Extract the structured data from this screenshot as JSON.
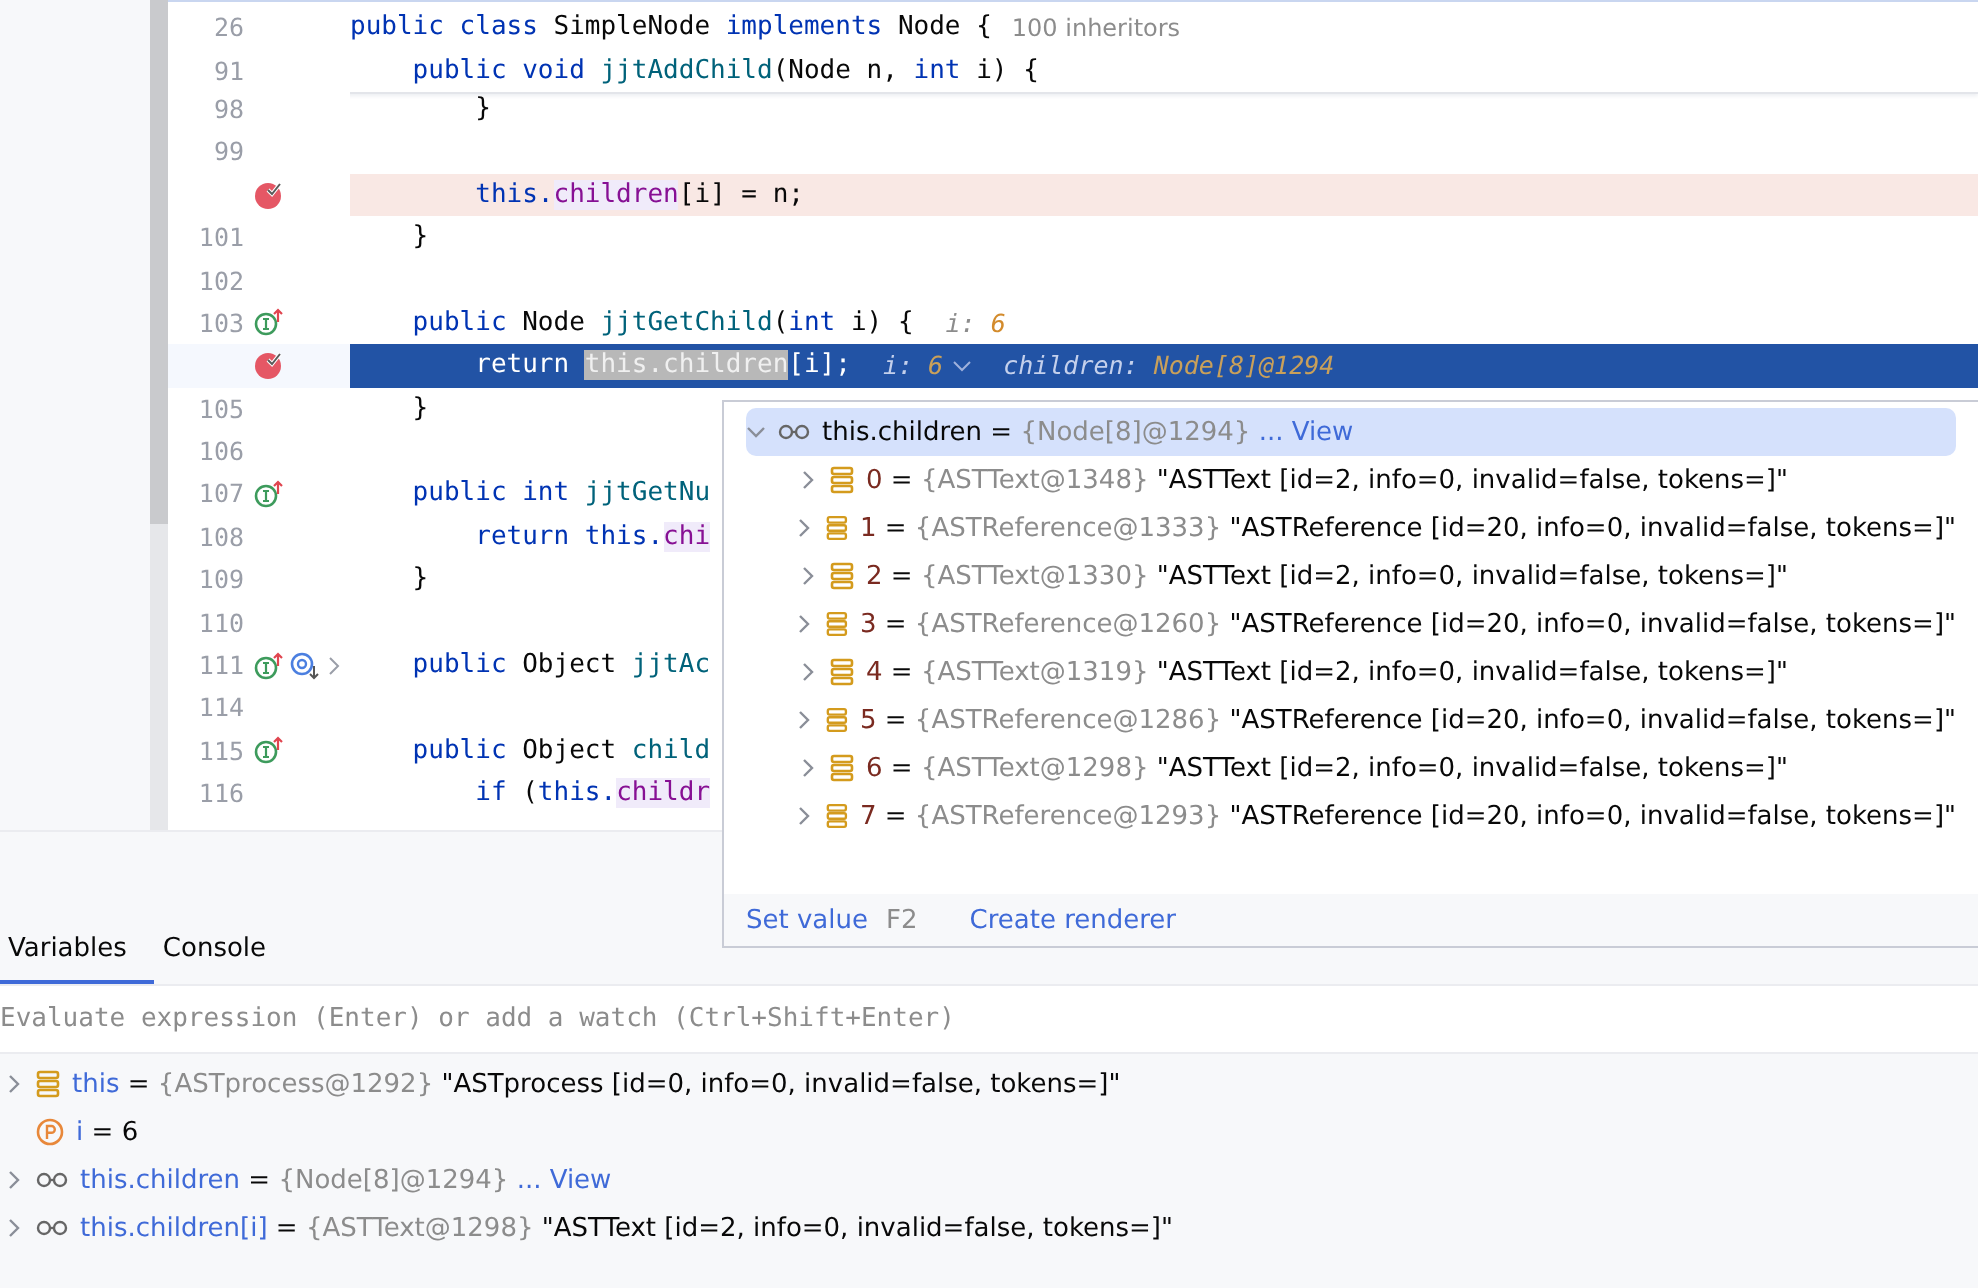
{
  "editor": {
    "sticky_lines": [
      {
        "number": "26",
        "tokens": [
          {
            "text": "public class ",
            "kind": "kw"
          },
          {
            "text": "SimpleNode ",
            "kind": "plain"
          },
          {
            "text": "implements ",
            "kind": "kw"
          },
          {
            "text": "Node {",
            "kind": "plain"
          }
        ],
        "hints": [
          {
            "text": "100 inheritors",
            "kind": "usage"
          }
        ]
      },
      {
        "number": "91",
        "tokens": [
          {
            "text": "    public void ",
            "kind": "kw"
          },
          {
            "text": "jjtAddChild",
            "kind": "method"
          },
          {
            "text": "(Node n, ",
            "kind": "plain"
          },
          {
            "text": "int ",
            "kind": "kw"
          },
          {
            "text": "i) {",
            "kind": "plain"
          }
        ]
      }
    ],
    "lines": [
      {
        "number": "98",
        "kind": "code",
        "tokens": [
          {
            "text": "        }",
            "kind": "plain"
          }
        ]
      },
      {
        "number": "99",
        "kind": "code"
      },
      {
        "kind": "breakpoint",
        "gutter": [
          {
            "kind": "breakpoint"
          }
        ],
        "tokens": [
          {
            "text": "        this.",
            "kind": "kw"
          },
          {
            "text": "children",
            "kind": "field-ref"
          },
          {
            "text": "[i] = n;",
            "kind": "plain"
          }
        ]
      },
      {
        "number": "101",
        "kind": "code",
        "tokens": [
          {
            "text": "    }",
            "kind": "plain"
          }
        ]
      },
      {
        "number": "102",
        "kind": "code"
      },
      {
        "number": "103",
        "kind": "code",
        "gutter": [
          {
            "kind": "implements"
          }
        ],
        "tokens": [
          {
            "text": "    public ",
            "kind": "kw"
          },
          {
            "text": "Node ",
            "kind": "plain"
          },
          {
            "text": "jjtGetChild",
            "kind": "method"
          },
          {
            "text": "(",
            "kind": "plain"
          },
          {
            "text": "int ",
            "kind": "kw"
          },
          {
            "text": "i) {",
            "kind": "plain"
          }
        ],
        "hints": [
          {
            "text": "i: ",
            "value": "6",
            "kind": "value",
            "expandable": false
          }
        ]
      },
      {
        "kind": "current",
        "gutter": [
          {
            "kind": "breakpoint"
          }
        ],
        "tokens": [
          {
            "text": "        return ",
            "kind": "kw"
          },
          {
            "text": "this.children",
            "kind": "eval"
          },
          {
            "text": "[i];",
            "kind": "plain"
          }
        ],
        "hints": [
          {
            "text": "i: ",
            "value": "6",
            "kind": "value",
            "expandable": true
          },
          {
            "text": "children: ",
            "value": "Node[8]@1294",
            "kind": "value",
            "expandable": false
          }
        ]
      },
      {
        "number": "105",
        "kind": "code",
        "tokens": [
          {
            "text": "    }",
            "kind": "plain"
          }
        ]
      },
      {
        "number": "106",
        "kind": "code"
      },
      {
        "number": "107",
        "kind": "code",
        "gutter": [
          {
            "kind": "implements"
          }
        ],
        "tokens": [
          {
            "text": "    public int ",
            "kind": "kw"
          },
          {
            "text": "jjtGetNu",
            "kind": "method"
          }
        ]
      },
      {
        "number": "108",
        "kind": "code",
        "tokens": [
          {
            "text": "        return this.",
            "kind": "kw"
          },
          {
            "text": "chi",
            "kind": "field-ref"
          }
        ]
      },
      {
        "number": "109",
        "kind": "code",
        "tokens": [
          {
            "text": "    }",
            "kind": "plain"
          }
        ]
      },
      {
        "number": "110",
        "kind": "code"
      },
      {
        "number": "111",
        "kind": "code",
        "gutter": [
          {
            "kind": "implements"
          },
          {
            "kind": "overridden"
          },
          {
            "kind": "fold"
          }
        ],
        "tokens": [
          {
            "text": "    public ",
            "kind": "kw"
          },
          {
            "text": "Object ",
            "kind": "plain"
          },
          {
            "text": "jjtAc",
            "kind": "method"
          }
        ]
      },
      {
        "number": "114",
        "kind": "code"
      },
      {
        "number": "115",
        "kind": "code",
        "gutter": [
          {
            "kind": "implements"
          }
        ],
        "tokens": [
          {
            "text": "    public ",
            "kind": "kw"
          },
          {
            "text": "Object ",
            "kind": "plain"
          },
          {
            "text": "child",
            "kind": "method"
          }
        ]
      },
      {
        "number": "116",
        "kind": "code",
        "tokens": [
          {
            "text": "        if ",
            "kind": "kw"
          },
          {
            "text": "(",
            "kind": "plain"
          },
          {
            "text": "this.",
            "kind": "kw"
          },
          {
            "text": "childr",
            "kind": "field-ref"
          }
        ]
      }
    ]
  },
  "popup": {
    "root": {
      "name": "this.children",
      "operator": "=",
      "type": "{Node[8]@1294}",
      "link": "... View",
      "expanded": true,
      "selected": true,
      "kind": "watch"
    },
    "children": [
      {
        "name": "0",
        "operator": "=",
        "type": "{ASTText@1348}",
        "value": "\"ASTText [id=2, info=0, invalid=false, tokens=]\"",
        "expanded": false,
        "kind": "object"
      },
      {
        "name": "1",
        "operator": "=",
        "type": "{ASTReference@1333}",
        "value": "\"ASTReference [id=20, info=0, invalid=false, tokens=]\"",
        "expanded": false,
        "kind": "object"
      },
      {
        "name": "2",
        "operator": "=",
        "type": "{ASTText@1330}",
        "value": "\"ASTText [id=2, info=0, invalid=false, tokens=]\"",
        "expanded": false,
        "kind": "object"
      },
      {
        "name": "3",
        "operator": "=",
        "type": "{ASTReference@1260}",
        "value": "\"ASTReference [id=20, info=0, invalid=false, tokens=]\"",
        "expanded": false,
        "kind": "object"
      },
      {
        "name": "4",
        "operator": "=",
        "type": "{ASTText@1319}",
        "value": "\"ASTText [id=2, info=0, invalid=false, tokens=]\"",
        "expanded": false,
        "kind": "object"
      },
      {
        "name": "5",
        "operator": "=",
        "type": "{ASTReference@1286}",
        "value": "\"ASTReference [id=20, info=0, invalid=false, tokens=]\"",
        "expanded": false,
        "kind": "object"
      },
      {
        "name": "6",
        "operator": "=",
        "type": "{ASTText@1298}",
        "value": "\"ASTText [id=2, info=0, invalid=false, tokens=]\"",
        "expanded": false,
        "kind": "object"
      },
      {
        "name": "7",
        "operator": "=",
        "type": "{ASTReference@1293}",
        "value": "\"ASTReference [id=20, info=0, invalid=false, tokens=]\"",
        "expanded": false,
        "kind": "object"
      }
    ],
    "actions": [
      {
        "label": "Set value",
        "shortcut": "F2"
      },
      {
        "label": "Create renderer"
      }
    ]
  },
  "debugger": {
    "tabs": [
      {
        "label": "Variables",
        "selected": true
      },
      {
        "label": "Console",
        "selected": false
      }
    ],
    "evaluate": {
      "placeholder": "Evaluate expression (Enter) or add a watch (Ctrl+Shift+Enter)"
    },
    "variables": [
      {
        "name": "this",
        "operator": "=",
        "type": "{ASTprocess@1292}",
        "value": "\"ASTprocess [id=0, info=0, invalid=false, tokens=]\"",
        "expandable": true,
        "kind": "object"
      },
      {
        "name": "i",
        "operator": "=",
        "value": "6",
        "expandable": false,
        "kind": "param"
      },
      {
        "name": "this.children",
        "operator": "=",
        "type": "{Node[8]@1294}",
        "link": "... View",
        "expandable": true,
        "kind": "watch"
      },
      {
        "name": "this.children[i]",
        "operator": "=",
        "type": "{ASTText@1298}",
        "value": "\"ASTText [id=2, info=0, invalid=false, tokens=]\"",
        "expandable": true,
        "kind": "watch"
      }
    ]
  }
}
